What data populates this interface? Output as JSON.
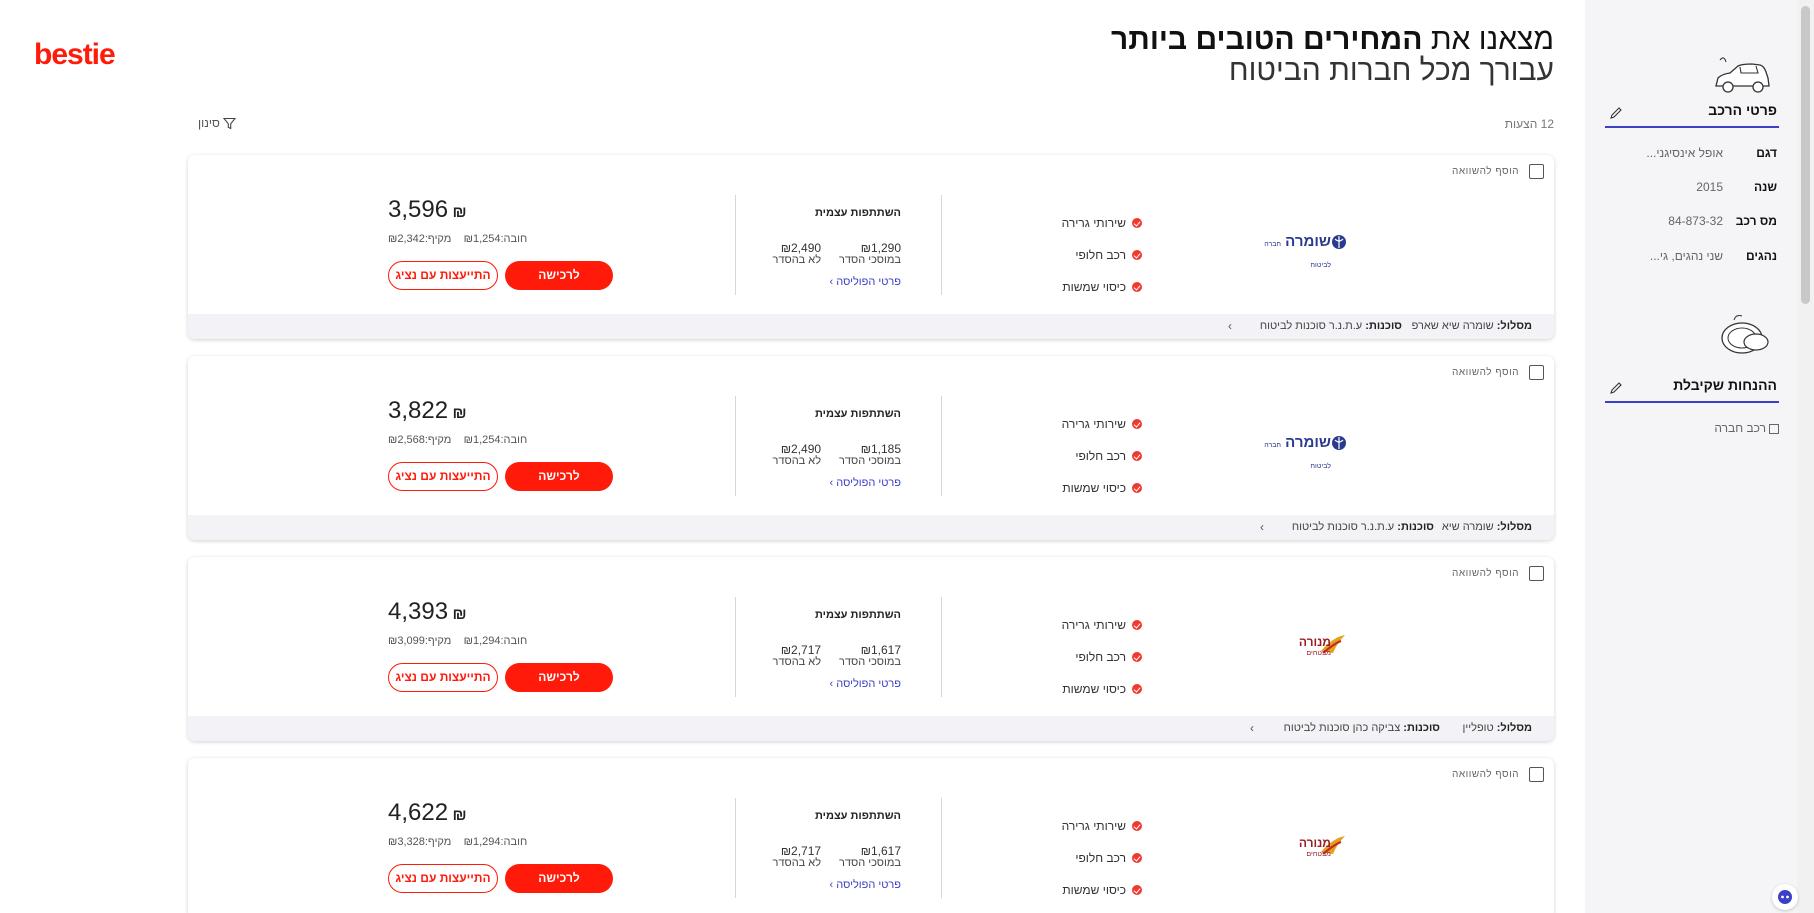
{
  "brand": {
    "logo_text": "bestie",
    "accent": "#ff1a0a",
    "link_color": "#3b40c7"
  },
  "hero": {
    "line1_plain": "מצאנו את",
    "line1_bold": "המחירים הטובים ביותר",
    "line2": "עבורך מכל חברות הביטוח"
  },
  "results": {
    "count_label": "12 הצעות",
    "filter_label": "סינון"
  },
  "sidebar": {
    "vehicle_title": "פרטי הרכב",
    "specs": [
      {
        "key": "דגם",
        "value": "אופל אינסיגני..."
      },
      {
        "key": "שנה",
        "value": "2015"
      },
      {
        "key": "מס רכב",
        "value": "84-873-32"
      },
      {
        "key": "נהגים",
        "value": "שני נהגים, גי..."
      }
    ],
    "discounts_title": "ההנחות שקיבלת",
    "discounts": [
      "רכב חברה"
    ]
  },
  "labels": {
    "add_compare": "הוסף להשוואה",
    "deductibles_title": "השתתפות עצמית",
    "in_network": "במוסכי הסדר",
    "out_network": "לא בהסדר",
    "policy_details": "פרטי הפוליסה",
    "buy": "לרכישה",
    "consult": "התייעצות עם נציג",
    "track_key": "מסלול:",
    "agency_key": "סוכנות:",
    "comp_key": "מקיף:",
    "mand_key": "חובה:",
    "currency": "₪"
  },
  "offers": [
    {
      "insurer": "שומרה",
      "insurer_sub": "חברה לביטוח",
      "insurer_icon": "shomera-logo",
      "covers": [
        "שירותי גרירה",
        "רכב חלופי",
        "כיסוי שמשות"
      ],
      "in_network": "1,290",
      "out_network": "2,490",
      "price": "3,596",
      "comprehensive": "2,342",
      "mandatory": "1,254",
      "track": "שומרה שיא שארפ",
      "agency": "ע.ת.נ.ר סוכנות לביטוח"
    },
    {
      "insurer": "שומרה",
      "insurer_sub": "חברה לביטוח",
      "insurer_icon": "shomera-logo",
      "covers": [
        "שירותי גרירה",
        "רכב חלופי",
        "כיסוי שמשות"
      ],
      "in_network": "1,185",
      "out_network": "2,490",
      "price": "3,822",
      "comprehensive": "2,568",
      "mandatory": "1,254",
      "track": "שומרה שיא",
      "agency": "ע.ת.נ.ר סוכנות לביטוח"
    },
    {
      "insurer": "מנורה",
      "insurer_sub": "מבטחים",
      "insurer_icon": "menora-logo",
      "covers": [
        "שירותי גרירה",
        "רכב חלופי",
        "כיסוי שמשות"
      ],
      "in_network": "1,617",
      "out_network": "2,717",
      "price": "4,393",
      "comprehensive": "3,099",
      "mandatory": "1,294",
      "track": "טופליין",
      "agency": "צביקה כהן סוכנות לביטוח"
    },
    {
      "insurer": "מנורה",
      "insurer_sub": "מבטחים",
      "insurer_icon": "menora-logo",
      "covers": [
        "שירותי גרירה",
        "רכב חלופי",
        "כיסוי שמשות"
      ],
      "in_network": "1,617",
      "out_network": "2,717",
      "price": "4,622",
      "comprehensive": "3,328",
      "mandatory": "1,294",
      "track": "",
      "agency": ""
    }
  ]
}
